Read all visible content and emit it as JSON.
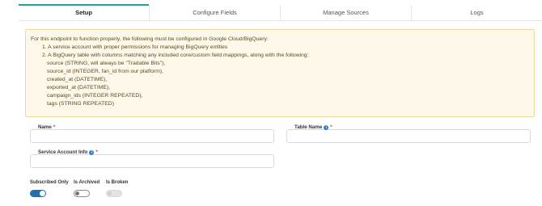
{
  "tabs": [
    {
      "label": "Setup",
      "active": true
    },
    {
      "label": "Configure Fields",
      "active": false
    },
    {
      "label": "Manage Sources",
      "active": false
    },
    {
      "label": "Logs",
      "active": false
    }
  ],
  "notice": {
    "intro": "For this endpoint to function properly, the following must be configured in Google Cloud/BigQuery:",
    "item1": "1. A service account with proper permissions for managing BigQuery entities",
    "item2": "2. A BigQuery table with columns matching any included core/custom field mappings, along with the following:",
    "columns": [
      "source (STRING, will always be \"Tradable Bits\"),",
      "source_id (INTEGER, fan_id from our platform),",
      "created_at (DATETIME),",
      "exported_at (DATETIME),",
      "campaign_ids (INTEGER REPEATED),",
      "tags (STRING REPEATED)"
    ]
  },
  "form": {
    "name_label": "Name",
    "table_name_label": "Table Name",
    "service_account_label": "Service Account Info",
    "required_mark": "*",
    "name_value": "",
    "table_name_value": "",
    "service_account_value": ""
  },
  "toggles": {
    "subscribed_only": {
      "label": "Subscribed Only",
      "state": "on"
    },
    "is_archived": {
      "label": "Is Archived",
      "state": "off"
    },
    "is_broken": {
      "label": "Is Broken",
      "state": "disabled"
    }
  },
  "colors": {
    "tab_accent": "#1aa88e",
    "notice_bg": "#fdf8ea",
    "notice_border": "#efd8a0",
    "toggle_on": "#1f6fb5",
    "info_icon": "#2f7fc1"
  }
}
